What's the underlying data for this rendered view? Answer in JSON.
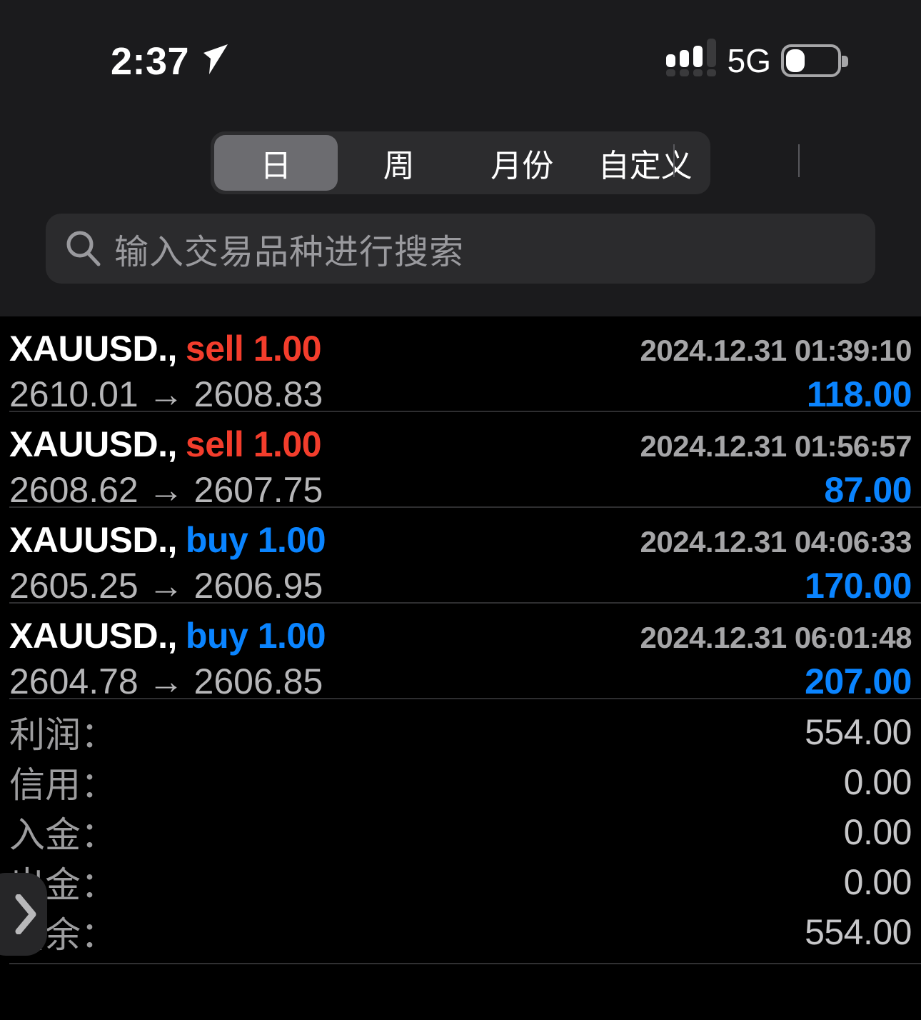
{
  "status_bar": {
    "time": "2:37",
    "location_icon": "location-arrow-icon",
    "signal_icon": "cellular-signal-icon",
    "network": "5G",
    "battery_icon": "battery-low-icon"
  },
  "period_tabs": {
    "items": [
      {
        "label": "日",
        "selected": true
      },
      {
        "label": "周",
        "selected": false
      },
      {
        "label": "月份",
        "selected": false
      },
      {
        "label": "自定义",
        "selected": false
      }
    ]
  },
  "search": {
    "icon": "search-icon",
    "placeholder": "输入交易品种进行搜索",
    "value": ""
  },
  "deals": [
    {
      "symbol": "XAUUSD.,",
      "side": "sell 1.00",
      "side_type": "sell",
      "time": "2024.12.31 01:39:10",
      "prices": "2610.01 → 2608.83",
      "profit": "118.00"
    },
    {
      "symbol": "XAUUSD.,",
      "side": "sell 1.00",
      "side_type": "sell",
      "time": "2024.12.31 01:56:57",
      "prices": "2608.62 → 2607.75",
      "profit": "87.00"
    },
    {
      "symbol": "XAUUSD.,",
      "side": "buy 1.00",
      "side_type": "buy",
      "time": "2024.12.31 04:06:33",
      "prices": "2605.25 → 2606.95",
      "profit": "170.00"
    },
    {
      "symbol": "XAUUSD.,",
      "side": "buy 1.00",
      "side_type": "buy",
      "time": "2024.12.31 06:01:48",
      "prices": "2604.78 → 2606.85",
      "profit": "207.00"
    }
  ],
  "summary": [
    {
      "label": "利润：",
      "value": "554.00"
    },
    {
      "label": "信用：",
      "value": "0.00"
    },
    {
      "label": "入金：",
      "value": "0.00"
    },
    {
      "label": "出金：",
      "value": "0.00"
    },
    {
      "label": "结余：",
      "value": "554.00"
    }
  ],
  "floating_handle": {
    "icon": "chevron-right-icon"
  },
  "colors": {
    "background": "#000000",
    "header_background": "#1b1b1d",
    "control_background": "#2c2c2e",
    "selected_segment": "#6c6c70",
    "buy_blue": "#0a84ff",
    "sell_red": "#f33d2c",
    "profit_blue": "#0a84ff",
    "muted_text": "#9d9d9f"
  }
}
